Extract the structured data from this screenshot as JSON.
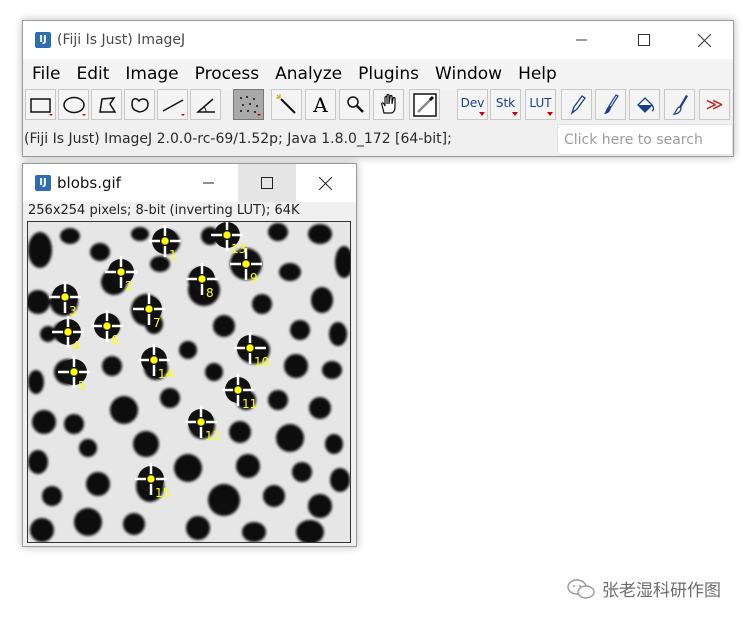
{
  "main_window": {
    "title": "(Fiji Is Just) ImageJ",
    "menu": [
      "File",
      "Edit",
      "Image",
      "Process",
      "Analyze",
      "Plugins",
      "Window",
      "Help"
    ],
    "tools": [
      {
        "name": "rectangle-tool-button",
        "icon": "rectangle"
      },
      {
        "name": "oval-tool-button",
        "icon": "oval"
      },
      {
        "name": "polygon-tool-button",
        "icon": "polygon"
      },
      {
        "name": "freehand-tool-button",
        "icon": "freehand"
      },
      {
        "name": "line-tool-button",
        "icon": "line"
      },
      {
        "name": "angle-tool-button",
        "icon": "angle"
      },
      {
        "name": "multipoint-tool-button",
        "icon": "multipoint",
        "selected": true
      },
      {
        "name": "wand-tool-button",
        "icon": "wand"
      },
      {
        "name": "text-tool-button",
        "icon": "text",
        "label": "A"
      },
      {
        "name": "magnifier-tool-button",
        "icon": "magnifier"
      },
      {
        "name": "hand-tool-button",
        "icon": "hand"
      },
      {
        "name": "color-picker-tool-button",
        "icon": "color-picker"
      },
      {
        "name": "dev-menu-button",
        "icon": "dev",
        "label": "Dev"
      },
      {
        "name": "stk-menu-button",
        "icon": "stk",
        "label": "Stk"
      },
      {
        "name": "lut-menu-button",
        "icon": "lut",
        "label": "LUT"
      },
      {
        "name": "pencil-tool-button",
        "icon": "pencil"
      },
      {
        "name": "paintbrush-tool-button",
        "icon": "brush"
      },
      {
        "name": "flood-fill-tool-button",
        "icon": "flood-fill"
      },
      {
        "name": "brush-tool-button",
        "icon": "brush2"
      },
      {
        "name": "more-tools-button",
        "icon": "more",
        "label": "≫"
      }
    ],
    "status": "(Fiji Is Just) ImageJ 2.0.0-rc-69/1.52p; Java 1.8.0_172 [64-bit];",
    "search_placeholder": "Click here to search"
  },
  "image_window": {
    "title": "blobs.gif",
    "info": "256x254 pixels; 8-bit (inverting LUT); 64K",
    "points": [
      {
        "label": "1"
      },
      {
        "label": "2"
      },
      {
        "label": "3"
      },
      {
        "label": "4"
      },
      {
        "label": "5"
      },
      {
        "label": "6"
      },
      {
        "label": "7"
      },
      {
        "label": "8"
      },
      {
        "label": "9"
      },
      {
        "label": "10"
      },
      {
        "label": "11"
      },
      {
        "label": "12"
      },
      {
        "label": "13"
      },
      {
        "label": "14"
      },
      {
        "label": "15"
      }
    ]
  },
  "watermark": {
    "text": "张老湿科研作图"
  },
  "colors": {
    "point_marker": "#ffff00",
    "crosshair": "#ffffff",
    "blob": "#111111",
    "background": "#e6e6e6",
    "title_icon": "#2f6db3",
    "more_arrow": "#cc2222"
  }
}
